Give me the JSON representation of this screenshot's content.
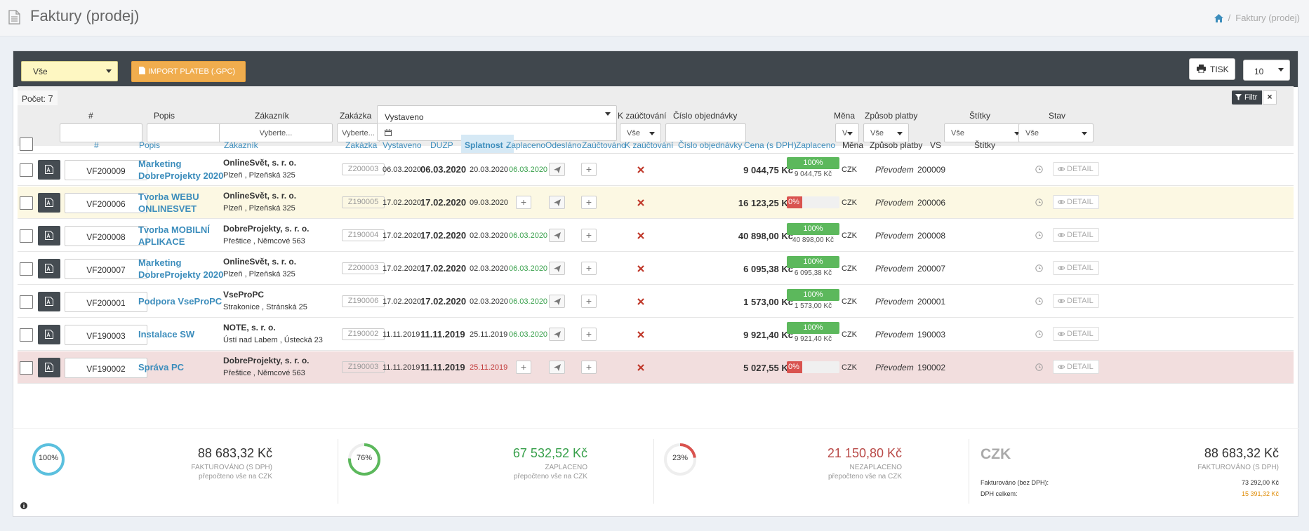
{
  "header": {
    "title": "Faktury (prodej)",
    "breadcrumb_current": "Faktury (prodej)"
  },
  "toolbar": {
    "filter_select": "Vše",
    "import_label": "IMPORT PLATEB (.GPC)",
    "print_label": "TISK",
    "page_size": "10"
  },
  "filters": {
    "count_label": "Počet:",
    "count_value": "7",
    "filtr_label": "Filtr",
    "close_label": "×",
    "labels": {
      "num": "#",
      "popis": "Popis",
      "zakaznik": "Zákazník",
      "zakazka": "Zakázka",
      "vystaveno": "Vystaveno",
      "k_zauctovani": "K zaúčtování",
      "cislo_obj": "Číslo objednávky",
      "mena": "Měna",
      "zpusob": "Způsob platby",
      "stitky": "Štítky",
      "stav": "Stav"
    },
    "zakaznik_placeholder": "Vyberte...",
    "zakazka_placeholder": "Vyberte...",
    "k_zauctovani_value": "Vše",
    "mena_value": "V",
    "zpusob_value": "Vše",
    "stitky_value": "Vše",
    "stav_value": "Vše"
  },
  "columns": {
    "num": "#",
    "popis": "Popis",
    "zakaznik": "Zákazník",
    "zakazka": "Zakázka",
    "vystaveno": "Vystaveno",
    "duzp": "DUZP",
    "splatnost": "Splatnost",
    "zaplaceno": "Zaplaceno",
    "odeslano": "Odesláno",
    "zauctovano": "Zaúčtováno",
    "k_zauctovani": "K zaúčtování",
    "cislo_obj": "Číslo objednávky",
    "cena": "Cena (s DPH)",
    "zaplaceno2": "Zaplaceno",
    "mena": "Měna",
    "zpusob": "Způsob platby",
    "vs": "VS",
    "stitky": "Štítky"
  },
  "rows": [
    {
      "num": "VF200009",
      "popis": "Marketing DobreProjekty 2020",
      "cust_name": "OnlineSvět, s. r. o.",
      "cust_addr": "Plzeň , Plzeňská 325",
      "zakazka": "Z200003",
      "vystaveno": "06.03.2020",
      "duzp": "06.03.2020",
      "splatnost": "20.03.2020",
      "zaplaceno_date": "06.03.2020",
      "cena": "9 044,75 Kč",
      "paid_pct": 100,
      "paid_label": "100%",
      "paid_amount": "9 044,75 Kč",
      "mena": "CZK",
      "zpusob": "Převodem",
      "vs": "200009",
      "detail": "DETAIL",
      "status": "normal"
    },
    {
      "num": "VF200006",
      "popis": "Tvorba WEBU ONLINESVET",
      "cust_name": "OnlineSvět, s. r. o.",
      "cust_addr": "Plzeň , Plzeňská 325",
      "zakazka": "Z190005",
      "vystaveno": "17.02.2020",
      "duzp": "17.02.2020",
      "splatnost": "09.03.2020",
      "zaplaceno_date": "",
      "cena": "16 123,25 Kč",
      "paid_pct": 0,
      "paid_label": "0%",
      "paid_amount": "",
      "mena": "CZK",
      "zpusob": "Převodem",
      "vs": "200006",
      "detail": "DETAIL",
      "status": "warn"
    },
    {
      "num": "VF200008",
      "popis": "Tvorba MOBILNÍ APLIKACE",
      "cust_name": "DobreProjekty, s. r. o.",
      "cust_addr": "Přeštice , Němcové 563",
      "zakazka": "Z190004",
      "vystaveno": "17.02.2020",
      "duzp": "17.02.2020",
      "splatnost": "02.03.2020",
      "zaplaceno_date": "06.03.2020",
      "cena": "40 898,00 Kč",
      "paid_pct": 100,
      "paid_label": "100%",
      "paid_amount": "40 898,00 Kč",
      "mena": "CZK",
      "zpusob": "Převodem",
      "vs": "200008",
      "detail": "DETAIL",
      "status": "normal"
    },
    {
      "num": "VF200007",
      "popis": "Marketing DobreProjekty 2020",
      "cust_name": "OnlineSvět, s. r. o.",
      "cust_addr": "Plzeň , Plzeňská 325",
      "zakazka": "Z200003",
      "vystaveno": "17.02.2020",
      "duzp": "17.02.2020",
      "splatnost": "02.03.2020",
      "zaplaceno_date": "06.03.2020",
      "cena": "6 095,38 Kč",
      "paid_pct": 100,
      "paid_label": "100%",
      "paid_amount": "6 095,38 Kč",
      "mena": "CZK",
      "zpusob": "Převodem",
      "vs": "200007",
      "detail": "DETAIL",
      "status": "normal"
    },
    {
      "num": "VF200001",
      "popis": "Podpora VseProPC",
      "cust_name": "VseProPC",
      "cust_addr": "Strakonice , Stránská 25",
      "zakazka": "Z190006",
      "vystaveno": "17.02.2020",
      "duzp": "17.02.2020",
      "splatnost": "02.03.2020",
      "zaplaceno_date": "06.03.2020",
      "cena": "1 573,00 Kč",
      "paid_pct": 100,
      "paid_label": "100%",
      "paid_amount": "1 573,00 Kč",
      "mena": "CZK",
      "zpusob": "Převodem",
      "vs": "200001",
      "detail": "DETAIL",
      "status": "normal"
    },
    {
      "num": "VF190003",
      "popis": "Instalace SW",
      "cust_name": "NOTE, s. r. o.",
      "cust_addr": "Ústí nad Labem , Ústecká 23",
      "zakazka": "Z190002",
      "vystaveno": "11.11.2019",
      "duzp": "11.11.2019",
      "splatnost": "25.11.2019",
      "zaplaceno_date": "06.03.2020",
      "cena": "9 921,40 Kč",
      "paid_pct": 100,
      "paid_label": "100%",
      "paid_amount": "9 921,40 Kč",
      "mena": "CZK",
      "zpusob": "Převodem",
      "vs": "190003",
      "detail": "DETAIL",
      "status": "normal"
    },
    {
      "num": "VF190002",
      "popis": "Správa PC",
      "cust_name": "DobreProjekty, s. r. o.",
      "cust_addr": "Přeštice , Němcové 563",
      "zakazka": "Z190003",
      "vystaveno": "11.11.2019",
      "duzp": "11.11.2019",
      "splatnost": "25.11.2019",
      "zaplaceno_date": "",
      "cena": "5 027,55 Kč",
      "paid_pct": 0,
      "paid_label": "0%",
      "paid_amount": "",
      "mena": "CZK",
      "zpusob": "Převodem",
      "vs": "190002",
      "detail": "DETAIL",
      "status": "danger"
    }
  ],
  "summary": {
    "total": {
      "pct": 100,
      "pct_label": "100%",
      "value": "88 683,32 Kč",
      "cap1": "FAKTUROVÁNO (S DPH)",
      "cap2": "přepočteno vše na CZK",
      "color": "#5bc0de"
    },
    "paid": {
      "pct": 76,
      "pct_label": "76%",
      "value": "67 532,52 Kč",
      "cap1": "ZAPLACENO",
      "cap2": "přepočteno vše na CZK",
      "color": "#5cb85c"
    },
    "unpaid": {
      "pct": 23,
      "pct_label": "23%",
      "value": "21 150,80 Kč",
      "cap1": "NEZAPLACENO",
      "cap2": "přepočteno vše na CZK",
      "color": "#d9534f"
    },
    "currency": {
      "code": "CZK",
      "value": "88 683,32 Kč",
      "cap1": "FAKTUROVÁNO (S DPH)",
      "bez_dph_label": "Fakturováno (bez DPH):",
      "bez_dph_value": "73 292,00 Kč",
      "dph_label": "DPH celkem:",
      "dph_value": "15 391,32 Kč"
    }
  },
  "colors": {
    "toolbar_bg": "#40474d",
    "accent": "#3c8dbc",
    "import_btn": "#f0ad4e",
    "success": "#5cb85c",
    "danger": "#d9534f",
    "warn_row": "#fcf8e3",
    "danger_row": "#f2dede"
  }
}
